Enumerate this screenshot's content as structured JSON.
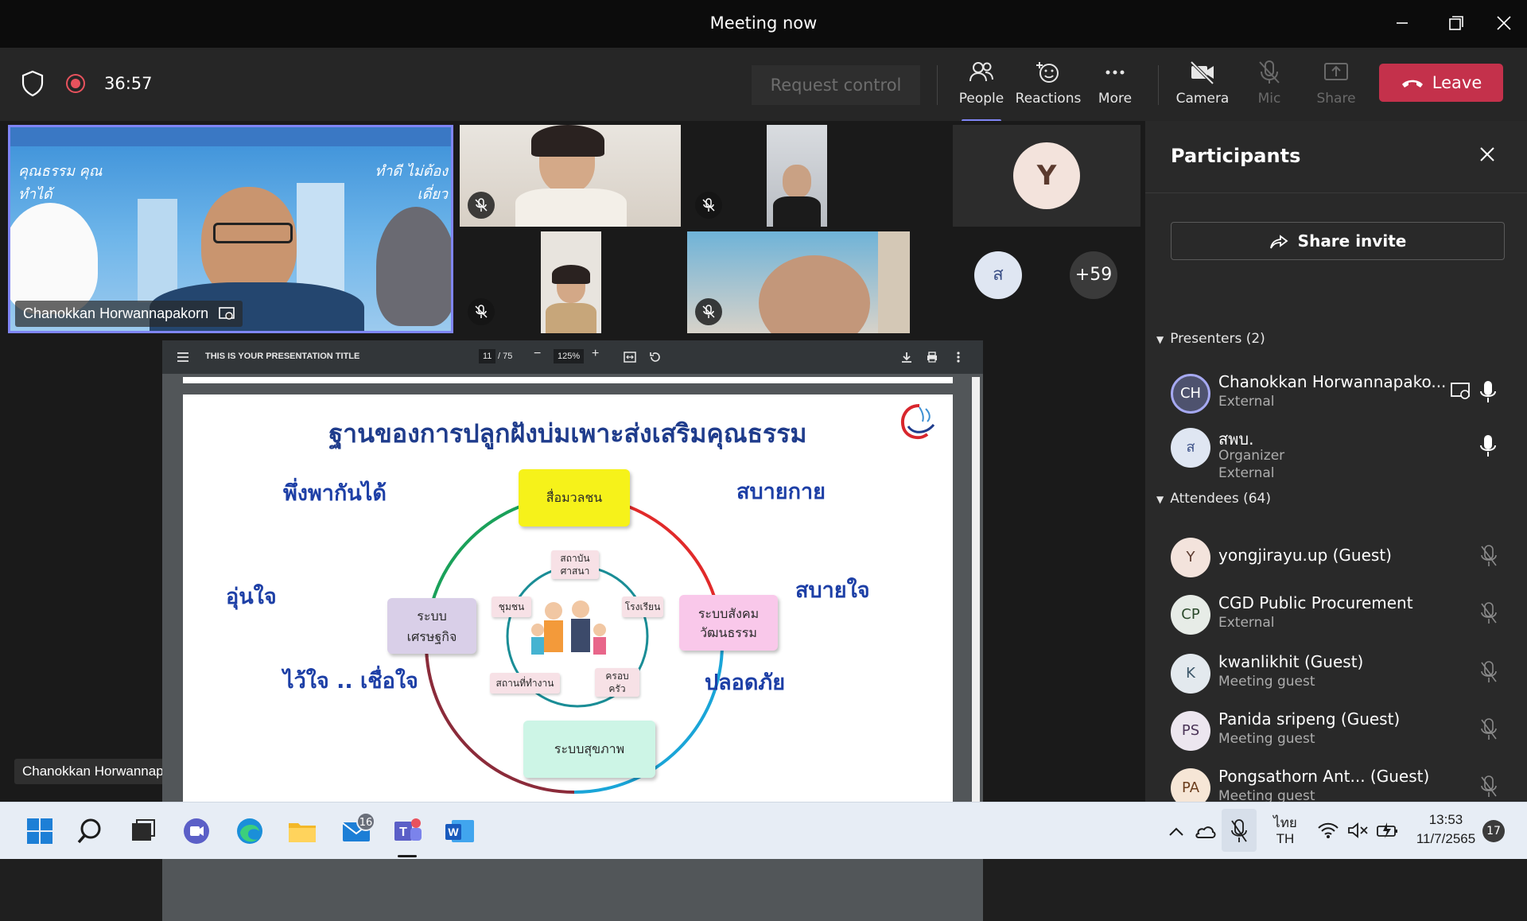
{
  "window": {
    "title": "Meeting now"
  },
  "toolbar": {
    "elapsed": "36:57",
    "request_control": "Request control",
    "people": "People",
    "reactions": "Reactions",
    "more": "More",
    "camera": "Camera",
    "mic": "Mic",
    "share": "Share",
    "leave": "Leave"
  },
  "stage": {
    "main_speaker_name": "Chanokkan Horwannapakorn",
    "bottom_name_tag": "Chanokkan Horwannapakorn",
    "avatar_y": "Y",
    "avatar_s": "ส",
    "overflow": "+59",
    "speaker_banner_left": "คุณธรรม คุณทำได้",
    "speaker_banner_right": "ทำดี ไม่ต้องเดี่ยว"
  },
  "presentation": {
    "doc_title": "THIS IS YOUR PRESENTATION TITLE",
    "page_current": "11",
    "page_total": "/ 75",
    "zoom": "125%",
    "slide": {
      "title": "ฐานของการปลูกฝังบ่มเพาะส่งเสริมคุณธรรม",
      "words": {
        "depend": "พึ่งพากันได้",
        "comfort_body": "สบายกาย",
        "warm": "อุ่นใจ",
        "comfort_mind": "สบายใจ",
        "trust": "ไว้ใจ .. เชื่อใจ",
        "safe": "ปลอดภัย"
      },
      "boxes": {
        "media": "สื่อมวลชน",
        "social_line1": "ระบบสังคม",
        "social_line2": "วัฒนธรรม",
        "econ_line1": "ระบบ",
        "econ_line2": "เศรษฐกิจ",
        "health": "ระบบสุขภาพ"
      },
      "small": {
        "religion_1": "สถาบัน",
        "religion_2": "ศาสนา",
        "community": "ชุมชน",
        "school": "โรงเรียน",
        "workplace": "สถานที่ทำงาน",
        "family_1": "ครอบ",
        "family_2": "ครัว"
      }
    }
  },
  "participants": {
    "title": "Participants",
    "share_invite": "Share invite",
    "presenters_label": "Presenters (2)",
    "attendees_label": "Attendees (64)",
    "presenters": [
      {
        "initials": "CH",
        "name": "Chanokkan Horwannapako...",
        "sub1": "External",
        "sub2": ""
      },
      {
        "initials": "ส",
        "name": "สพบ.",
        "sub1": "Organizer",
        "sub2": "External"
      }
    ],
    "attendees": [
      {
        "initials": "Y",
        "name": "yongjirayu.up (Guest)",
        "sub1": ""
      },
      {
        "initials": "CP",
        "name": "CGD Public Procurement",
        "sub1": "External"
      },
      {
        "initials": "K",
        "name": "kwanlikhit (Guest)",
        "sub1": "Meeting guest"
      },
      {
        "initials": "PS",
        "name": "Panida sripeng (Guest)",
        "sub1": "Meeting guest"
      },
      {
        "initials": "PA",
        "name": "Pongsathorn Ant... (Guest)",
        "sub1": "Meeting guest"
      }
    ]
  },
  "taskbar": {
    "mail_badge": "16",
    "lang_line1": "ไทย",
    "lang_line2": "TH",
    "time": "13:53",
    "date": "11/7/2565",
    "notif_count": "17"
  },
  "colors": {
    "accent": "#7f85f5",
    "leave": "#c4314b",
    "panel": "#292929"
  }
}
